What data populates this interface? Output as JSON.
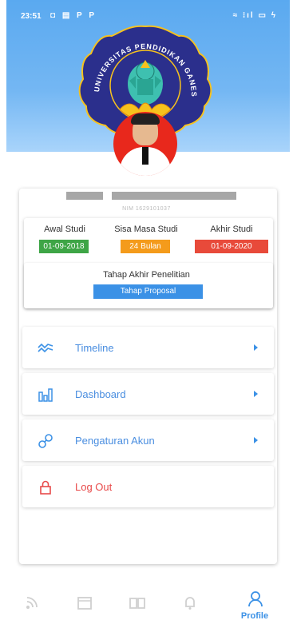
{
  "status_bar": {
    "time": "23:51",
    "left_icons": "◘ ▤ P P",
    "right_icons": "≈ ⁝ıl ▭ ϟ",
    "battery": "38"
  },
  "emblem": {
    "text": "UNIVERSITAS PENDIDIKAN GANESHA",
    "description": "university-emblem"
  },
  "profile": {
    "nim_text": "NIM 1629101037"
  },
  "study": {
    "awal": {
      "label": "Awal Studi",
      "value": "01-09-2018",
      "color": "#3ea546"
    },
    "sisa": {
      "label": "Sisa Masa Studi",
      "value": "24 Bulan",
      "color": "#f49b1b"
    },
    "akhir": {
      "label": "Akhir Studi",
      "value": "01-09-2020",
      "color": "#e84a3a"
    },
    "tahap_title": "Tahap Akhir Penelitian",
    "tahap_value": "Tahap Proposal",
    "tahap_color": "#3b91e6"
  },
  "menu": [
    {
      "label": "Timeline",
      "icon": "timeline-icon"
    },
    {
      "label": "Dashboard",
      "icon": "chart-icon"
    },
    {
      "label": "Pengaturan Akun",
      "icon": "settings-link-icon"
    },
    {
      "label": "Log Out",
      "icon": "lock-icon"
    }
  ],
  "bottom_nav": {
    "items": [
      "feed-icon",
      "calendar-icon",
      "book-icon",
      "bell-icon",
      "profile-icon"
    ],
    "active_label": "Profile"
  },
  "colors": {
    "accent": "#3b91e6",
    "logout": "#e84a4a"
  }
}
